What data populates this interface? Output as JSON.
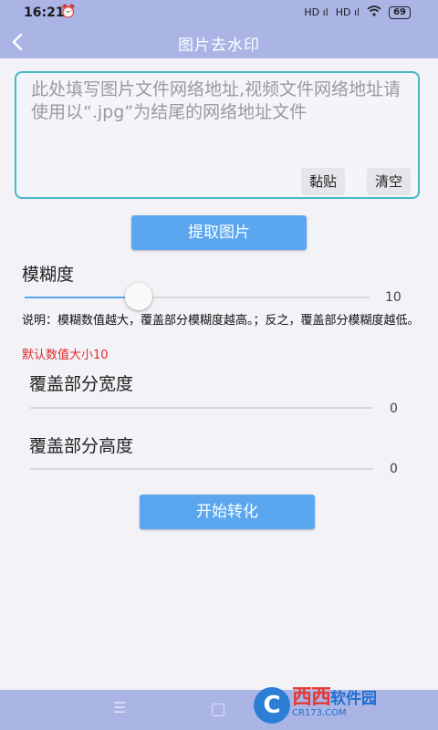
{
  "status_bar": {
    "time": "16:21",
    "alarm_icon": "alarm-icon",
    "signal1": "HD ıl",
    "signal2": "HD ıl",
    "wifi_icon": "wifi-icon",
    "battery": "69"
  },
  "app_bar": {
    "back_icon": "back-arrow-icon",
    "title": "图片去水印"
  },
  "url_input": {
    "placeholder": "此处填写图片文件网络地址,视频文件网络地址请使用以“.jpg”为结尾的网络地址文件",
    "value": ""
  },
  "buttons": {
    "paste": "黏贴",
    "clear": "清空",
    "extract": "提取图片",
    "convert": "开始转化"
  },
  "blur": {
    "label": "模糊度",
    "value": "10",
    "level": 0.33,
    "description": "说明：模糊数值越大，覆盖部分模糊度越高。；反之，覆盖部分模糊度越低。",
    "default_note": "默认数值大小10"
  },
  "cover_width": {
    "label": "覆盖部分宽度",
    "value": "0"
  },
  "cover_height": {
    "label": "覆盖部分高度",
    "value": "0"
  },
  "nav_bar": {
    "menu_icon": "menu-icon",
    "home_icon": "home-icon"
  },
  "watermark": {
    "logo_letter": "C",
    "brand": "西西",
    "brand2": "软件园",
    "site": "CR173.COM"
  },
  "colors": {
    "accent": "#5aa6ef",
    "header": "#aab5e6",
    "input_border": "#47b8c6",
    "warning_text": "#e02b2b"
  }
}
